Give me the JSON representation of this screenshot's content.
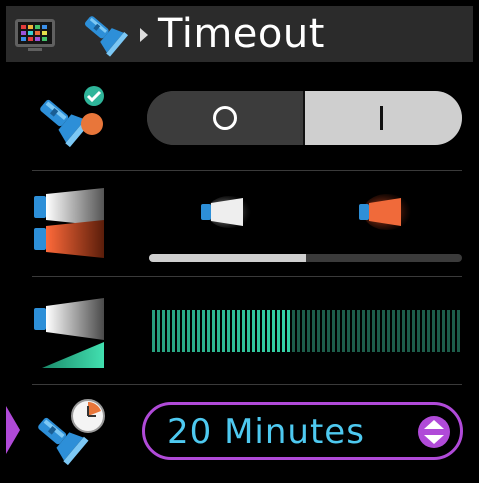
{
  "header": {
    "title": "Timeout",
    "app_icon": "mosaic-grid-icon",
    "section_icon": "flashlight-icon",
    "breadcrumb_separator": "chevron-right-icon"
  },
  "settings": {
    "power": {
      "icon": "flashlight-status-icon",
      "off_label_glyph": "O",
      "on_label_glyph": "I",
      "selected": "on"
    },
    "light_mode": {
      "icon": "flashlight-mode-icon",
      "options": [
        "white-beam",
        "red-beam"
      ],
      "selected_index": 0,
      "selected_fraction": 0.5
    },
    "brightness": {
      "icon": "brightness-icon",
      "level_fraction": 0.45
    },
    "timeout": {
      "icon": "flashlight-timer-icon",
      "value": "20 Minutes",
      "stepper_icon": "up-down-stepper-icon"
    }
  },
  "colors": {
    "accent": "#b04ad8",
    "value_text": "#4ec9f0",
    "meter_on": "#35d3a8",
    "meter_off": "#1d5c4a",
    "toggle_on": "#cfcfcf",
    "toggle_off": "#3c3c3c"
  }
}
